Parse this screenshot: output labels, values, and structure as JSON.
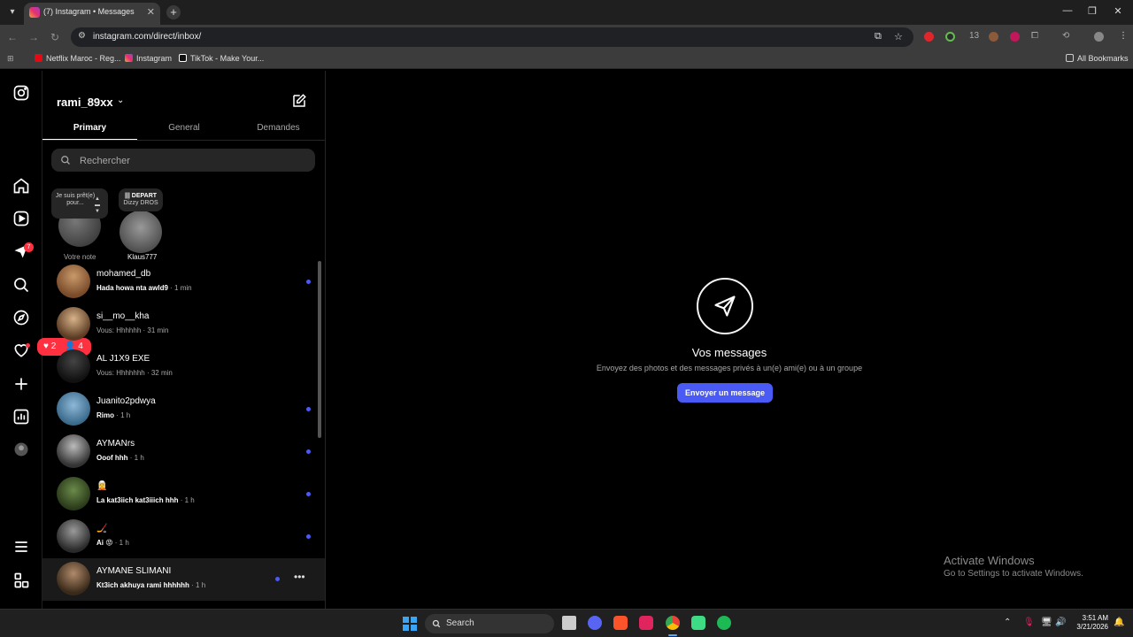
{
  "browser": {
    "tab_title": "(7) Instagram • Messages",
    "url": "instagram.com/direct/inbox/",
    "bookmarks": [
      "Netflix Maroc - Reg...",
      "Instagram",
      "TikTok - Make Your..."
    ],
    "all_bookmarks": "All Bookmarks",
    "extension_count": "13"
  },
  "rail": {
    "notification_badge": "7",
    "likes_count": "2",
    "followers_count": "4"
  },
  "inbox": {
    "username": "rami_89xx",
    "tabs": [
      "Primary",
      "General",
      "Demandes"
    ],
    "search_placeholder": "Rechercher",
    "notes": [
      {
        "bubble": "Je suis prêt(e) pour...",
        "name": "Votre note"
      },
      {
        "bubble_title": "DEPART",
        "bubble_sub": "Dizzy DROS",
        "name": "Klaus777"
      }
    ],
    "conversations": [
      {
        "name": "mohamed_db",
        "message": "Hada howa nta awld9",
        "time": "· 1 min",
        "unread": true
      },
      {
        "name": "si__mo__kha",
        "message": "Vous: Hhhhhh",
        "time": "· 31 min",
        "unread": false
      },
      {
        "name": "AL J1X9 EXE",
        "message": "Vous: Hhhhhhh",
        "time": "· 32 min",
        "unread": false
      },
      {
        "name": "Juanito2pdwya",
        "message": "Rimo",
        "time": "· 1 h",
        "unread": true
      },
      {
        "name": "AYMANrs",
        "message": "Ooof hhh",
        "time": "· 1 h",
        "unread": true
      },
      {
        "name": "🧝",
        "message": "La kat3iich kat3iiich hhh",
        "time": "· 1 h",
        "unread": true
      },
      {
        "name": "🏒",
        "message": "Ai 😡",
        "time": "· 1 h",
        "unread": true
      },
      {
        "name": "AYMANE SLIMANI",
        "message": "Kt3ich akhuya rami hhhhhh",
        "time": "· 1 h",
        "unread": true
      }
    ]
  },
  "main": {
    "title": "Vos messages",
    "subtitle": "Envoyez des photos et des messages privés à un(e) ami(e) ou à un groupe",
    "button": "Envoyer un message"
  },
  "watermark": {
    "title": "Activate Windows",
    "subtitle": "Go to Settings to activate Windows."
  },
  "taskbar": {
    "search": "Search",
    "time": "3:51 AM",
    "date": "3/21/2026"
  }
}
